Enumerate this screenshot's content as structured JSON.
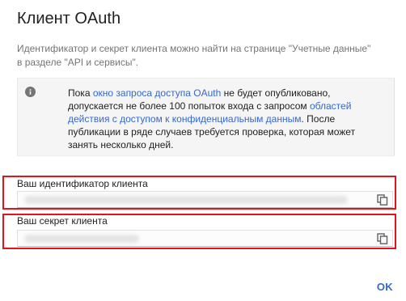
{
  "dialog": {
    "title": "Клиент OAuth",
    "intro": "Идентификатор и секрет клиента можно найти на странице \"Учетные данные\" в разделе \"API и сервисы\"."
  },
  "notice": {
    "icon": "info-icon",
    "text_1": "Пока ",
    "link_1": "окно запроса доступа OAuth",
    "text_2": " не будет опубликовано, допускается не более 100 попыток входа с запросом ",
    "link_2": "областей действия с доступом к конфиденциальным данным",
    "text_3": ". После публикации в ряде случаев требуется проверка, которая может занять несколько дней."
  },
  "client_id": {
    "label": "Ваш идентификатор клиента",
    "copy_icon": "copy-icon"
  },
  "client_secret": {
    "label": "Ваш секрет клиента",
    "copy_icon": "copy-icon"
  },
  "actions": {
    "ok_label": "OK"
  },
  "colors": {
    "accent": "#3367d6",
    "highlight_border": "#e1141c"
  }
}
